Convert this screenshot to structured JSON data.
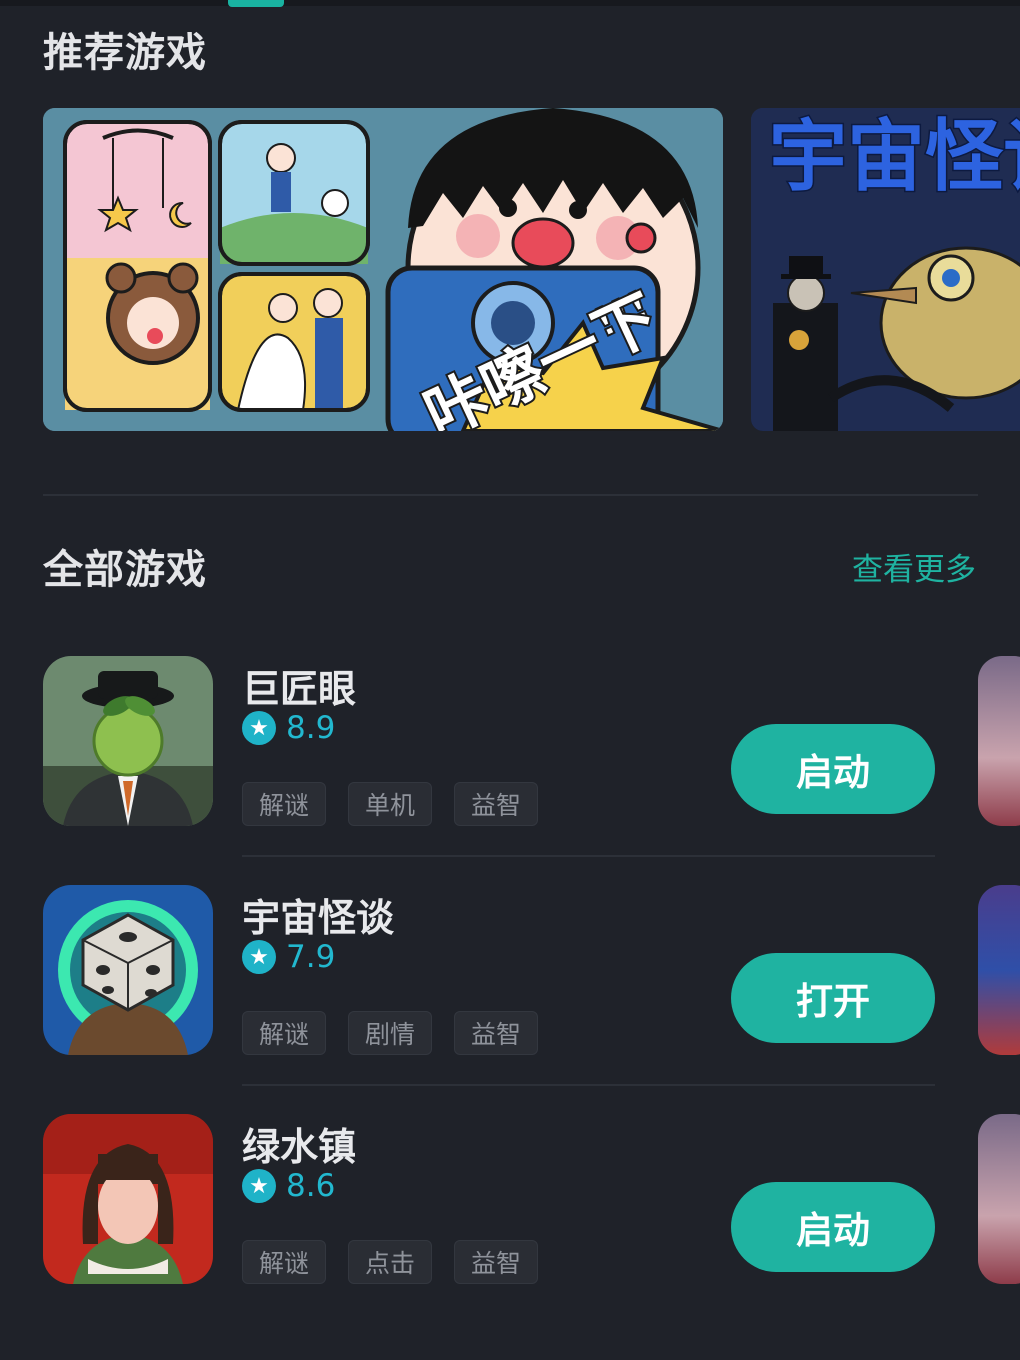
{
  "recommended": {
    "title": "推荐游戏",
    "banners": [
      {
        "caption": "咔嚓一下",
        "exclaim": "!!!"
      },
      {
        "caption": "宇宙怪谈"
      }
    ]
  },
  "all_games": {
    "title": "全部游戏",
    "see_more": "查看更多",
    "items": [
      {
        "name": "巨匠眼",
        "rating": "8.9",
        "tags": [
          "解谜",
          "单机",
          "益智"
        ],
        "action": "启动"
      },
      {
        "name": "宇宙怪谈",
        "rating": "7.9",
        "tags": [
          "解谜",
          "剧情",
          "益智"
        ],
        "action": "打开"
      },
      {
        "name": "绿水镇",
        "rating": "8.6",
        "tags": [
          "解谜",
          "点击",
          "益智"
        ],
        "action": "启动"
      }
    ]
  },
  "colors": {
    "accent": "#1fb3a1",
    "rating": "#22b8cf",
    "background": "#1f2229"
  },
  "icons": [
    "star-icon"
  ]
}
